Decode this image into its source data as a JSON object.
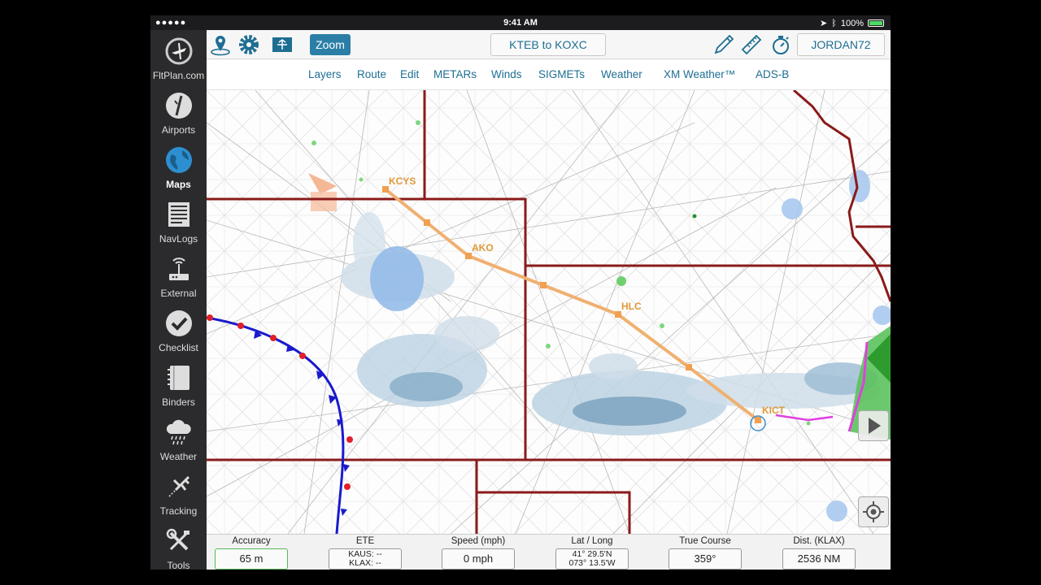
{
  "status_bar": {
    "signal": "●●●●● ",
    "time": "9:41 AM",
    "battery": "100%"
  },
  "sidebar": {
    "items": [
      {
        "label": "FltPlan.com",
        "icon": "fltplan-logo-icon"
      },
      {
        "label": "Airports",
        "icon": "airport-runway-icon"
      },
      {
        "label": "Maps",
        "icon": "globe-icon",
        "active": true
      },
      {
        "label": "NavLogs",
        "icon": "navlog-document-icon"
      },
      {
        "label": "External",
        "icon": "antenna-icon"
      },
      {
        "label": "Checklist",
        "icon": "checkmark-icon"
      },
      {
        "label": "Binders",
        "icon": "binder-icon"
      },
      {
        "label": "Weather",
        "icon": "rain-cloud-icon"
      },
      {
        "label": "Tracking",
        "icon": "plane-track-icon"
      },
      {
        "label": "Tools",
        "icon": "tools-icon"
      }
    ]
  },
  "toolbar": {
    "zoom_label": "Zoom",
    "route_label": "KTEB to KOXC",
    "user_label": "JORDAN72"
  },
  "menu": [
    "Layers",
    "Route",
    "Edit",
    "METARs",
    "Winds",
    "SIGMETs",
    "Weather",
    "XM Weather™",
    "ADS-B"
  ],
  "map": {
    "waypoints": [
      "KCYS",
      "AKO",
      "HLC",
      "KICT"
    ],
    "route_color": "#f0b070",
    "label_color": "#e09a3a"
  },
  "stats": {
    "accuracy": {
      "label": "Accuracy",
      "value": "65 m"
    },
    "ete": {
      "label": "ETE",
      "line1": "KAUS: --",
      "line2": "KLAX: --"
    },
    "speed": {
      "label": "Speed (mph)",
      "value": "0 mph"
    },
    "latlong": {
      "label": "Lat / Long",
      "line1": "41° 29.5'N",
      "line2": "073° 13.5'W"
    },
    "course": {
      "label": "True Course",
      "value": "359°"
    },
    "dist": {
      "label": "Dist. (KLAX)",
      "value": "2536 NM"
    }
  },
  "colors": {
    "accent": "#2b7fa6",
    "sidebar_bg": "#2b2b2d",
    "state_border": "#8b1a1a"
  }
}
